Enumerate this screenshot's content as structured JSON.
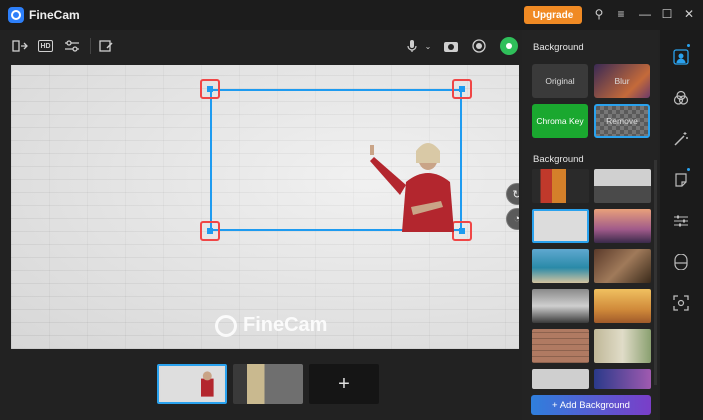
{
  "app": {
    "title": "FineCam",
    "upgrade_label": "Upgrade"
  },
  "window_controls": [
    "pin-icon",
    "menu-icon",
    "minimize-icon",
    "maximize-icon",
    "close-icon"
  ],
  "toolbar": {
    "left_icons": [
      "switch-camera-icon",
      "hd-icon",
      "adjust-sliders-icon",
      "edit-icon"
    ],
    "hd_label": "HD",
    "right_icons": [
      "microphone-icon",
      "camera-icon",
      "record-icon",
      "live-icon"
    ]
  },
  "preview": {
    "watermark": "FineCam"
  },
  "scenes": {
    "add_label": "+"
  },
  "panel": {
    "background_title": "Background",
    "options": [
      {
        "label": "Original"
      },
      {
        "label": "Blur"
      },
      {
        "label": "Chroma Key"
      },
      {
        "label": "Remove"
      }
    ],
    "gallery_title": "Background",
    "add_background_label": "+ Add Background"
  },
  "rail": [
    "person-icon",
    "filters-icon",
    "magic-icon",
    "sticker-icon",
    "adjust-icon",
    "mask-icon",
    "frame-icon"
  ],
  "colors": {
    "accent": "#2aa2ee",
    "upgrade": "#f08a24",
    "chroma": "#1aa82f",
    "live": "#2fbf5a"
  }
}
